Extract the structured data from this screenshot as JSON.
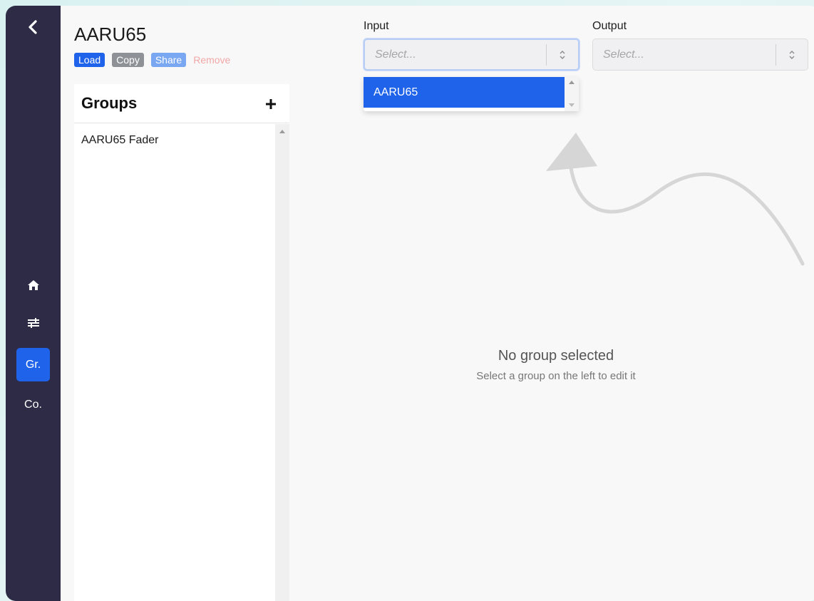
{
  "device": {
    "title": "AARU65"
  },
  "actions": {
    "load": "Load",
    "copy": "Copy",
    "share": "Share",
    "remove": "Remove"
  },
  "nav": {
    "items": [
      {
        "id": "home",
        "icon": "home-icon"
      },
      {
        "id": "settings",
        "icon": "sliders-icon"
      },
      {
        "id": "groups",
        "label": "Gr.",
        "active": true
      },
      {
        "id": "configs",
        "label": "Co."
      }
    ]
  },
  "groups": {
    "header": "Groups",
    "items": [
      {
        "label": "AARU65 Fader"
      }
    ]
  },
  "input": {
    "label": "Input",
    "placeholder": "Select...",
    "options": [
      "AARU65"
    ]
  },
  "output": {
    "label": "Output",
    "placeholder": "Select..."
  },
  "empty_state": {
    "title": "No group selected",
    "subtitle": "Select a group on the left to edit it"
  },
  "colors": {
    "accent": "#1e63e9",
    "rail": "#2d2b45",
    "remove": "#f2a7a7"
  }
}
